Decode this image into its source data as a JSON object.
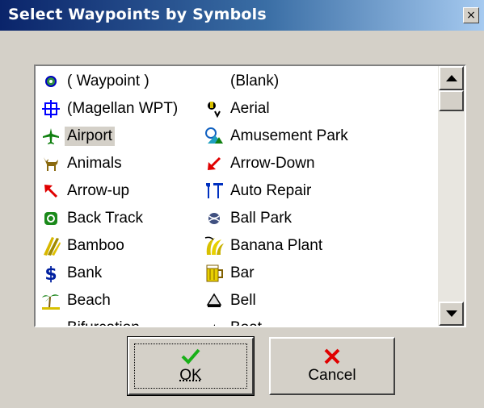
{
  "window": {
    "title": "Select Waypoints by Symbols",
    "close_glyph": "×"
  },
  "symbols": {
    "left": [
      {
        "label": "( Waypoint )",
        "icon": "waypoint-dot-icon"
      },
      {
        "label": "(Magellan WPT)",
        "icon": "crosshair-icon"
      },
      {
        "label": "Airport",
        "icon": "airplane-icon",
        "selected": true
      },
      {
        "label": "Animals",
        "icon": "deer-icon"
      },
      {
        "label": "Arrow-up",
        "icon": "arrow-up-icon"
      },
      {
        "label": "Back Track",
        "icon": "back-track-icon"
      },
      {
        "label": "Bamboo",
        "icon": "bamboo-icon"
      },
      {
        "label": "Bank",
        "icon": "dollar-icon"
      },
      {
        "label": "Beach",
        "icon": "palm-tree-icon"
      },
      {
        "label": "Bifurcation",
        "icon": "bifurcation-icon"
      }
    ],
    "right": [
      {
        "label": "(Blank)",
        "icon": "blank-icon"
      },
      {
        "label": "Aerial",
        "icon": "aerial-icon"
      },
      {
        "label": "Amusement Park",
        "icon": "amusement-park-icon"
      },
      {
        "label": "Arrow-Down",
        "icon": "arrow-down-icon"
      },
      {
        "label": "Auto Repair",
        "icon": "wrench-icon"
      },
      {
        "label": "Ball Park",
        "icon": "ball-icon"
      },
      {
        "label": "Banana Plant",
        "icon": "banana-icon"
      },
      {
        "label": "Bar",
        "icon": "beer-mug-icon"
      },
      {
        "label": "Bell",
        "icon": "bell-icon"
      },
      {
        "label": "Boat",
        "icon": "boat-icon"
      }
    ]
  },
  "buttons": {
    "ok_label": "OK",
    "cancel_label": "Cancel"
  },
  "colors": {
    "title_start": "#0a246a",
    "title_end": "#a6caf0",
    "face": "#d4d0c8"
  }
}
